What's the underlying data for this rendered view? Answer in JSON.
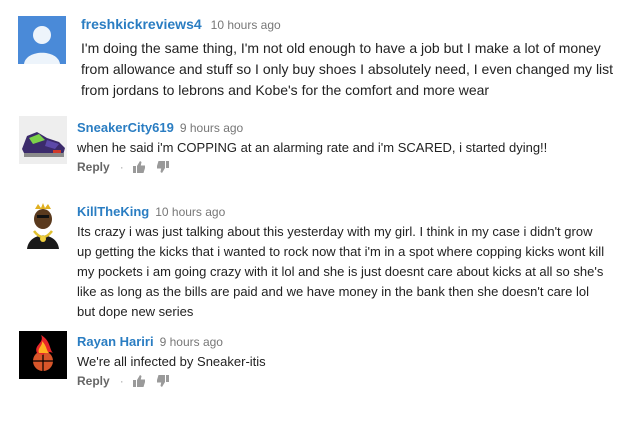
{
  "comments": [
    {
      "author": "freshkickreviews4",
      "time": "10 hours ago",
      "text": "I'm doing the same thing, I'm not old enough to have a job but I make a lot of money from allowance and stuff so I only buy shoes I absolutely need, I even changed my list from jordans to lebrons and Kobe's for the comfort and more wear"
    },
    {
      "author": "SneakerCity619",
      "time": "9 hours ago",
      "text": "when he said i'm COPPING at an alarming rate and i'm SCARED, i started dying!!",
      "reply_label": "Reply",
      "separator": "·"
    },
    {
      "author": "KillTheKing",
      "time": "10 hours ago",
      "text": "Its crazy i was just talking about this yesterday with my girl. I think in my case i didn't grow up getting the kicks that i wanted to rock now that i'm in a spot where copping kicks wont kill my pockets i am going crazy with it lol and she is just doesnt care about kicks at all so she's like as long as the bills are paid and we have money in the bank then she doesn't care lol but dope new series"
    },
    {
      "author": "Rayan Hariri",
      "time": "9 hours ago",
      "text": "We're all infected by Sneaker-itis",
      "reply_label": "Reply",
      "separator": "·"
    }
  ]
}
